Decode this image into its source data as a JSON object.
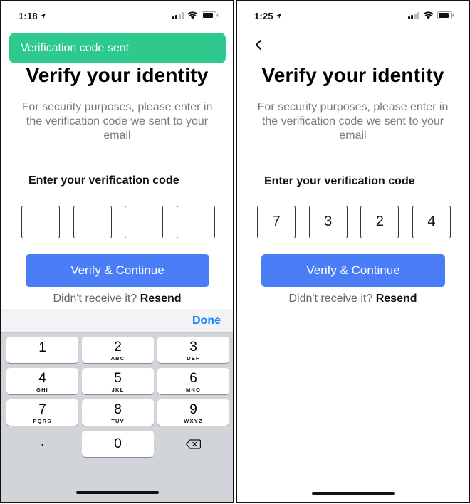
{
  "left": {
    "status": {
      "time": "1:18"
    },
    "toast": "Verification code sent",
    "title": "Verify your identity",
    "subtitle": "For security purposes, please enter in the verification code we sent to your email",
    "code_label": "Enter your verification code",
    "code_digits": [
      "",
      "",
      "",
      ""
    ],
    "verify_button": "Verify & Continue",
    "resend_prompt": "Didn't receive it?",
    "resend_link": "Resend",
    "keyboard": {
      "done": "Done",
      "keys": [
        {
          "num": "1",
          "letters": ""
        },
        {
          "num": "2",
          "letters": "ABC"
        },
        {
          "num": "3",
          "letters": "DEF"
        },
        {
          "num": "4",
          "letters": "GHI"
        },
        {
          "num": "5",
          "letters": "JKL"
        },
        {
          "num": "6",
          "letters": "MNO"
        },
        {
          "num": "7",
          "letters": "PQRS"
        },
        {
          "num": "8",
          "letters": "TUV"
        },
        {
          "num": "9",
          "letters": "WXYZ"
        },
        {
          "num": "0",
          "letters": ""
        }
      ],
      "decimal": "."
    }
  },
  "right": {
    "status": {
      "time": "1:25"
    },
    "title": "Verify your identity",
    "subtitle": "For security purposes, please enter in the verification code we sent to your email",
    "code_label": "Enter your verification code",
    "code_digits": [
      "7",
      "3",
      "2",
      "4"
    ],
    "verify_button": "Verify & Continue",
    "resend_prompt": "Didn't receive it?",
    "resend_link": "Resend"
  },
  "colors": {
    "toast": "#2ec98d",
    "primary_button": "#4b7ef6",
    "keyboard_done": "#1a82f7",
    "keyboard_bg": "#d1d4d9"
  },
  "icons": [
    "location-arrow-icon",
    "signal-icon",
    "wifi-icon",
    "battery-icon",
    "back-chevron-icon",
    "delete-backspace-icon"
  ]
}
